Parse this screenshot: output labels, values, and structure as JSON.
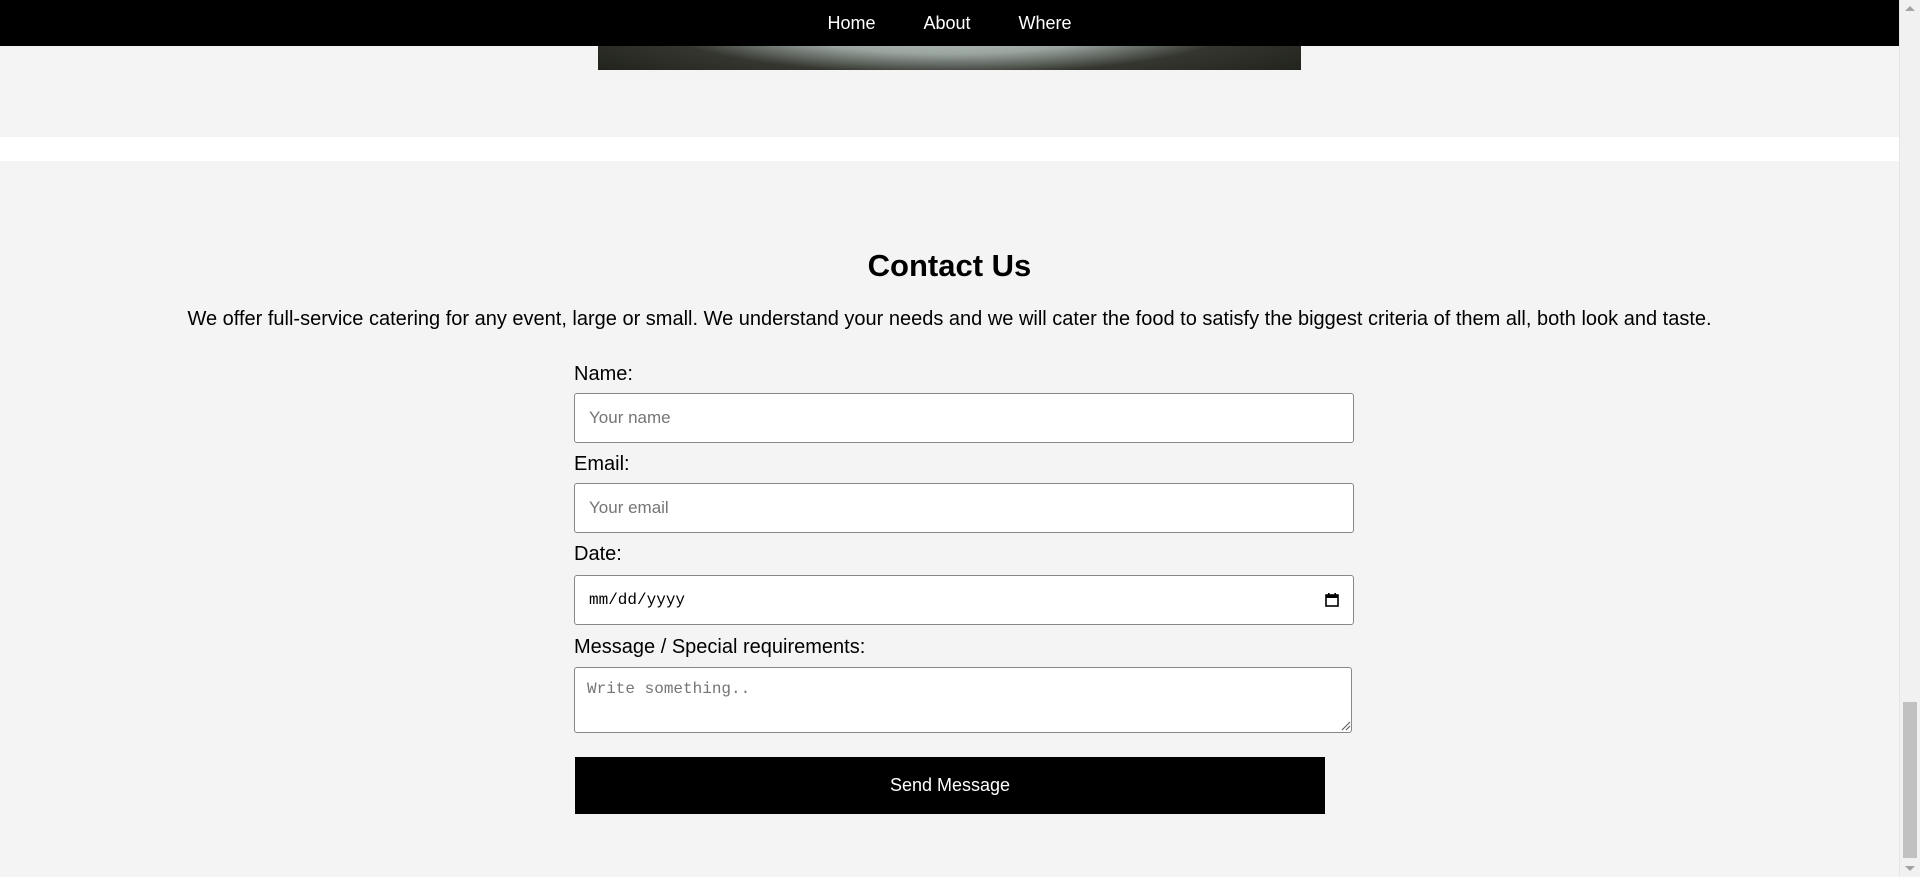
{
  "nav": {
    "items": [
      {
        "label": "Home"
      },
      {
        "label": "About"
      },
      {
        "label": "Where"
      }
    ]
  },
  "contact": {
    "title": "Contact Us",
    "intro": "We offer full-service catering for any event, large or small. We understand your needs and we will cater the food to satisfy the biggest criteria of them all, both look and taste.",
    "name_label": "Name:",
    "name_placeholder": "Your name",
    "email_label": "Email:",
    "email_placeholder": "Your email",
    "date_label": "Date:",
    "date_value": "mm/dd/yyyy",
    "message_label": "Message / Special requirements:",
    "message_placeholder": "Write something..",
    "submit_label": "Send Message"
  },
  "icons": {
    "date": "calendar-icon"
  },
  "colors": {
    "nav_bg": "#000000",
    "page_bg": "#f4f4f4",
    "button_bg": "#000000",
    "button_text": "#ffffff"
  }
}
